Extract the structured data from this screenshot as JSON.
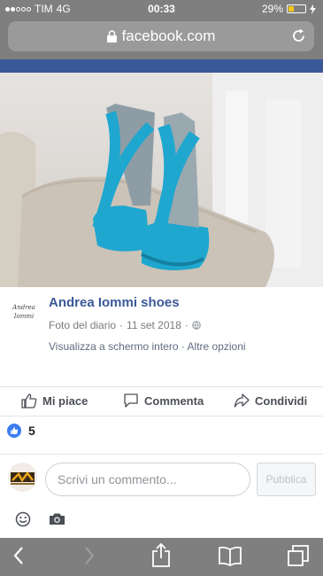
{
  "status_bar": {
    "carrier": "TIM",
    "network": "4G",
    "time": "00:33",
    "battery_percent": "29%",
    "battery_level": 0.29
  },
  "browser": {
    "url": "facebook.com"
  },
  "post": {
    "author": "Andrea Iommi shoes",
    "logo_text": "Andrea Iommi",
    "source": "Foto del diario",
    "separator": "·",
    "date": "11 set 2018",
    "link_fullscreen": "Visualizza a schermo intero",
    "link_more": "Altre opzioni",
    "links_separator": "·"
  },
  "actions": {
    "like": "Mi piace",
    "comment": "Commenta",
    "share": "Condividi"
  },
  "reactions": {
    "count": "5"
  },
  "comment_box": {
    "placeholder": "Scrivi un commento...",
    "publish": "Pubblica"
  },
  "colors": {
    "facebook_blue": "#3b5998",
    "shoe_teal": "#1fa7cf",
    "chrome_gray": "#7f7f7f"
  }
}
